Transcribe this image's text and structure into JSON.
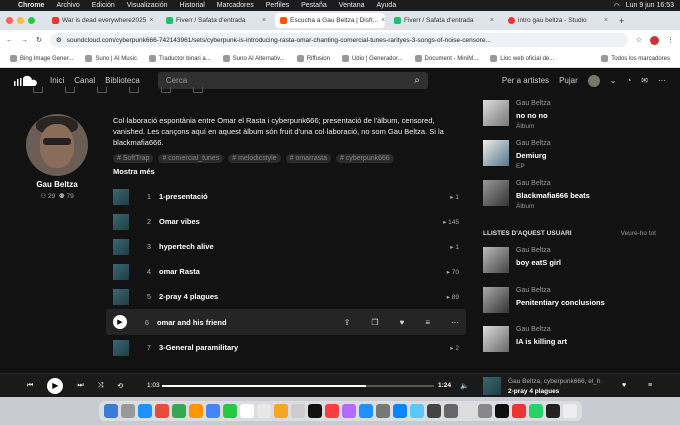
{
  "menubar": {
    "items": [
      "Chrome",
      "Archivo",
      "Edición",
      "Visualización",
      "Historial",
      "Marcadores",
      "Perfiles",
      "Pestaña",
      "Ventana",
      "Ayuda"
    ],
    "clock": "Lun 9 jun 16:53"
  },
  "tabs": [
    {
      "title": "War is dead everywhere2025",
      "color": "#e33",
      "active": false
    },
    {
      "title": "Fiverr / Safata d'entrada",
      "color": "#1dbf73",
      "active": false
    },
    {
      "title": "Escucha a Gau Beltza | Disfr...",
      "color": "#f50",
      "active": true
    },
    {
      "title": "Fiverr / Safata d'entrada",
      "color": "#1dbf73",
      "active": false
    },
    {
      "title": "intro gau beltza - Studio",
      "color": "#e33",
      "active": false
    }
  ],
  "address": {
    "url": "soundcloud.com/cyberpunk666-742143961/sets/cyberpunk-is-introducing-rasta-omar-chanting-comercial-tunes-rarityes-3-songs-of-noise-censore..."
  },
  "bookmarks": [
    "Bing Image Gener...",
    "Suno | AI Music",
    "Traductor binari a...",
    "Suno AI Alternativ...",
    "Riffusion",
    "Udio | Generador...",
    "Document - MiniM...",
    "Lloc web oficial de..."
  ],
  "bookmarks_all": "Todos los marcadores",
  "header": {
    "nav": [
      "Inici",
      "Canal",
      "Biblioteca"
    ],
    "search_placeholder": "Cerca",
    "for_artists": "Per a artistes",
    "upload": "Pujar"
  },
  "user": {
    "name": "Gau Beltza",
    "followers": "29",
    "following": "79"
  },
  "description": "Col·laboració espontània entre Omar el Rasta i cyberpunk666; presentació de l'àlbum, censored, vanished. Les cançons aquí en aquest àlbum són fruit d'una col·laboració, no som Gau Beltza. Si la blackmafia666.",
  "tags": [
    "# SoftTrap",
    "# comercial_tunes",
    "# melodicstyle",
    "# omarrasta",
    "# cyberpunk666"
  ],
  "show_more": "Mostra més",
  "tracks": [
    {
      "num": "1",
      "name": "1-presentació",
      "plays": "1"
    },
    {
      "num": "2",
      "name": "Omar vibes",
      "plays": "145"
    },
    {
      "num": "3",
      "name": "hypertech alive",
      "plays": "1"
    },
    {
      "num": "4",
      "name": "omar Rasta",
      "plays": "70"
    },
    {
      "num": "5",
      "name": "2-pray 4 plagues",
      "plays": "89"
    },
    {
      "num": "6",
      "name": "omar and his friend",
      "plays": ""
    },
    {
      "num": "7",
      "name": "3-General paramilitary",
      "plays": "2"
    }
  ],
  "albums": [
    {
      "artist": "Gau Beltza",
      "title": "no no no",
      "kind": "Àlbum"
    },
    {
      "artist": "Gau Beltza",
      "title": "Demiurg",
      "kind": "EP"
    },
    {
      "artist": "Gau Beltza",
      "title": "Blackmafia666 beats",
      "kind": "Àlbum"
    }
  ],
  "playlists_title": "LLISTES D'AQUEST USUARI",
  "playlists_more": "Veure-ho tot",
  "playlists": [
    {
      "artist": "Gau Beltza",
      "title": "boy eatS girl"
    },
    {
      "artist": "Gau Beltza",
      "title": "Penitentiary conclusions"
    },
    {
      "artist": "Gau Beltza",
      "title": "IA is killing art"
    }
  ],
  "player": {
    "current": "1:03",
    "total": "1:24",
    "progress": 0.75,
    "artist": "Gau Beltza, cyberpunk666, el_h",
    "track": "2-pray 4 plagues"
  }
}
